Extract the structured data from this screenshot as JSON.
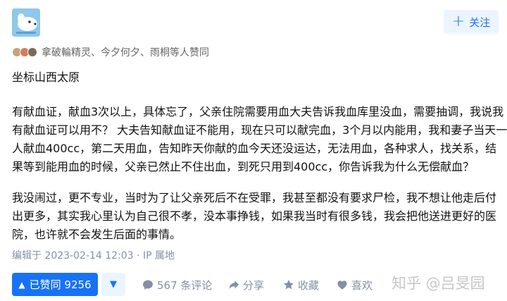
{
  "author": {
    "avatar_icon": "dog-avatar-icon"
  },
  "follow_button": {
    "label": "关注"
  },
  "voters": {
    "text": "拿破輪精灵、今夕何夕、雨桐等人赞同"
  },
  "answer": {
    "paragraphs": [
      [
        "坐标山西太原"
      ],
      [
        "有献血证，献血3次以上，具体忘了，父亲住院需要用血大夫告诉我血库里没血，需要抽调，我说我",
        "有献血证可以用不？ 大夫告知献血证不能用，现在只可以献完血，3个月以内能用，我和妻子当天一",
        "人献血400cc，第二天用血，告知昨天你献的血今天还没运达，无法用血，各种求人，找关系，结",
        "果等到能用血的时候，父亲已然止不住出血，到死只用到400cc，你告诉我为什么无偿献血？"
      ],
      [
        "我没闹过，更不专业，当时为了让父亲死后不在受罪，我甚至都没有要求尸检，我不想让他走后付",
        "出更多，其实我心里认为自己很不孝，没本事挣钱，如果我当时有很多钱，我会把他送进更好的医",
        "院，也许就不会发生后面的事情。"
      ]
    ],
    "meta": "编辑于 2023-02-14 12:03 · IP 属地"
  },
  "actions": {
    "vote_up_label": "已赞同 9256",
    "comment_label": "567 条评论",
    "share_label": "分享",
    "collect_label": "收藏",
    "like_label": "喜欢"
  },
  "watermark": "知乎 @吕旻园",
  "colors": {
    "accent": "#1772f6",
    "accent_light": "#ebf5ff",
    "muted": "#8590a6"
  }
}
